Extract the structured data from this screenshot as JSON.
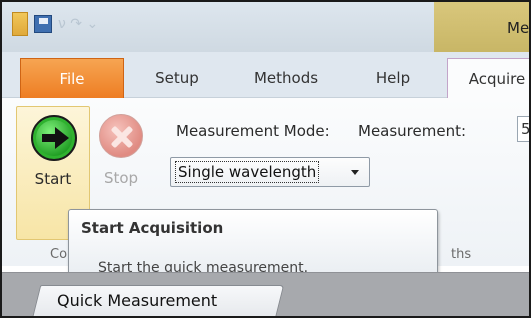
{
  "titlebar": {
    "title": "Me",
    "qat": {
      "faded_glyphs": "ν ↷ ⌄"
    }
  },
  "ribbon_tabs": [
    {
      "label": "File"
    },
    {
      "label": "Setup"
    },
    {
      "label": "Methods"
    },
    {
      "label": "Help"
    },
    {
      "label": "Acquire"
    }
  ],
  "acquire": {
    "start_label": "Start",
    "stop_label": "Stop",
    "measurement_mode_label": "Measurement Mode:",
    "measurement_label": "Measurement:",
    "measurement_value": "5",
    "mode_selected": "Single wavelength",
    "group_label_partial": "Co",
    "group_label_partial_right": "ths"
  },
  "tooltip": {
    "title": "Start Acquisition",
    "description": "Start the quick measurement."
  },
  "document_tabs": [
    {
      "label": "Quick Measurement"
    }
  ],
  "colors": {
    "file_tab": "#ee7d23",
    "start_button_bg": "#f7e5a6",
    "start_icon": "#1c9a20",
    "stop_icon": "#e08b82",
    "title_accent": "#c8b666"
  },
  "icons": {
    "app": "app-icon",
    "save": "save-icon",
    "start": "start-arrow-icon",
    "stop": "stop-x-icon",
    "dropdown": "chevron-down-icon"
  }
}
